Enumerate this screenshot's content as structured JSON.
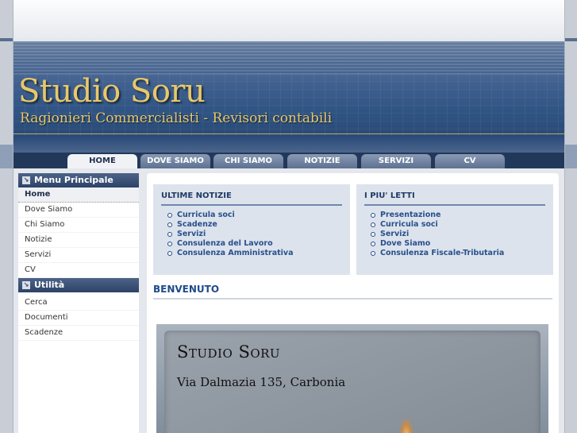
{
  "header": {
    "title": "Studio Soru",
    "subtitle": "Ragionieri Commercialisti - Revisori contabili"
  },
  "nav": {
    "tabs": [
      {
        "label": "HOME",
        "active": true
      },
      {
        "label": "DOVE SIAMO"
      },
      {
        "label": "CHI SIAMO"
      },
      {
        "label": "NOTIZIE"
      },
      {
        "label": "SERVIZI"
      },
      {
        "label": "CV"
      }
    ]
  },
  "sidebar": {
    "menu_title": "Menu Principale",
    "menu_items": [
      "Home",
      "Dove Siamo",
      "Chi Siamo",
      "Notizie",
      "Servizi",
      "CV"
    ],
    "utility_title": "Utilità",
    "utility_items": [
      "Cerca",
      "Documenti",
      "Scadenze"
    ]
  },
  "main": {
    "latest_news": {
      "title": "ULTIME NOTIZIE",
      "items": [
        "Curricula soci",
        "Scadenze",
        "Servizi",
        "Consulenza del Lavoro",
        "Consulenza Amministrativa"
      ]
    },
    "most_read": {
      "title": "I PIU' LETTI",
      "items": [
        "Presentazione",
        "Curricula soci",
        "Servizi",
        "Dove Siamo",
        "Consulenza Fiscale-Tributaria"
      ]
    },
    "welcome_title": "BENVENUTO",
    "photo": {
      "title": "Studio Soru",
      "address": "Via Dalmazia 135, Carbonia"
    }
  },
  "colors": {
    "accent": "#1f4a8c",
    "header_gold": "#e8c86a",
    "nav_bg": "#22385a"
  }
}
